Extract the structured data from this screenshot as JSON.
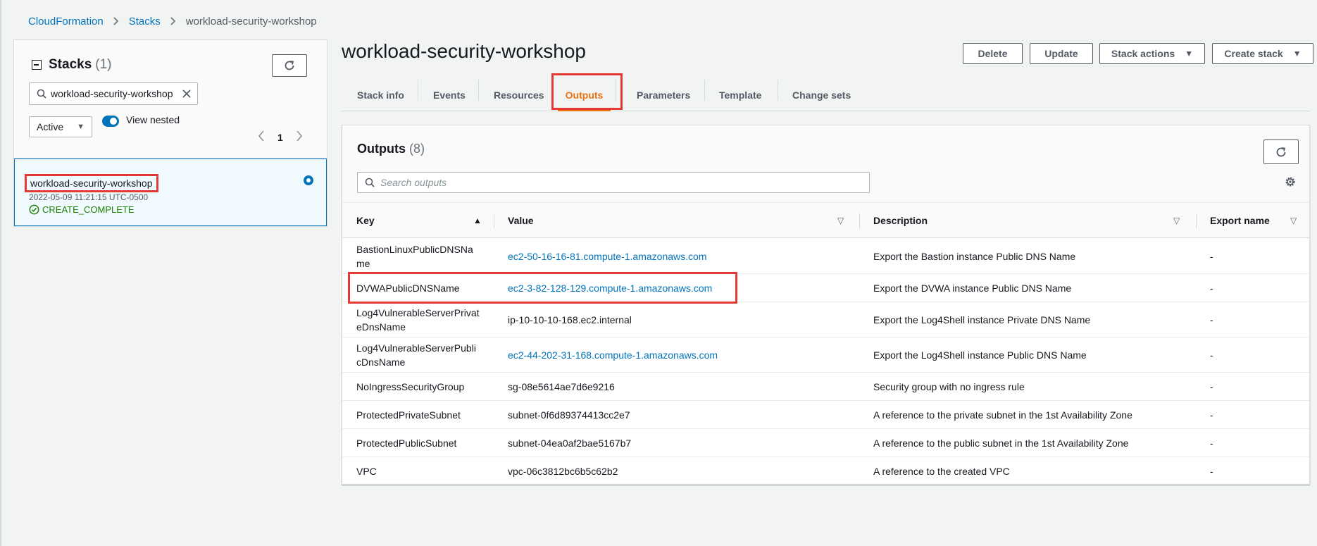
{
  "breadcrumb": {
    "items": [
      "CloudFormation",
      "Stacks",
      "workload-security-workshop"
    ]
  },
  "stacks_panel": {
    "title": "Stacks",
    "count": "(1)",
    "search_value": "workload-security-workshop",
    "status_filter": "Active",
    "view_nested_label": "View nested",
    "page": "1",
    "stack": {
      "name": "workload-security-workshop",
      "date": "2022-05-09 11:21:15 UTC-0500",
      "status": "CREATE_COMPLETE"
    }
  },
  "page_title": "workload-security-workshop",
  "actions": {
    "delete": "Delete",
    "update": "Update",
    "stack_actions": "Stack actions",
    "create_stack": "Create stack"
  },
  "tabs": [
    "Stack info",
    "Events",
    "Resources",
    "Outputs",
    "Parameters",
    "Template",
    "Change sets"
  ],
  "active_tab": "Outputs",
  "outputs": {
    "title": "Outputs",
    "count": "(8)",
    "search_placeholder": "Search outputs",
    "columns": [
      "Key",
      "Value",
      "Description",
      "Export name"
    ],
    "rows": [
      {
        "key": "BastionLinuxPublicDNSName",
        "value": "ec2-50-16-16-81.compute-1.amazonaws.com",
        "description": "Export the Bastion instance Public DNS Name",
        "export": "-"
      },
      {
        "key": "DVWAPublicDNSName",
        "value": "ec2-3-82-128-129.compute-1.amazonaws.com",
        "description": "Export the DVWA instance Public DNS Name",
        "export": "-"
      },
      {
        "key": "Log4VulnerableServerPrivateDnsName",
        "value": "ip-10-10-10-168.ec2.internal",
        "description": "Export the Log4Shell instance Private DNS Name",
        "export": "-"
      },
      {
        "key": "Log4VulnerableServerPublicDnsName",
        "value": "ec2-44-202-31-168.compute-1.amazonaws.com",
        "description": "Export the Log4Shell instance Public DNS Name",
        "export": "-"
      },
      {
        "key": "NoIngressSecurityGroup",
        "value": "sg-08e5614ae7d6e9216",
        "description": "Security group with no ingress rule",
        "export": "-"
      },
      {
        "key": "ProtectedPrivateSubnet",
        "value": "subnet-0f6d89374413cc2e7",
        "description": "A reference to the private subnet in the 1st Availability Zone",
        "export": "-"
      },
      {
        "key": "ProtectedPublicSubnet",
        "value": "subnet-04ea0af2bae5167b7",
        "description": "A reference to the public subnet in the 1st Availability Zone",
        "export": "-"
      },
      {
        "key": "VPC",
        "value": "vpc-06c3812bc6b5c62b2",
        "description": "A reference to the created VPC",
        "export": "-"
      }
    ]
  },
  "colors": {
    "link": "#0073bb",
    "active_tab": "#ec7211",
    "success": "#1d8102",
    "highlight": "#e53935"
  }
}
